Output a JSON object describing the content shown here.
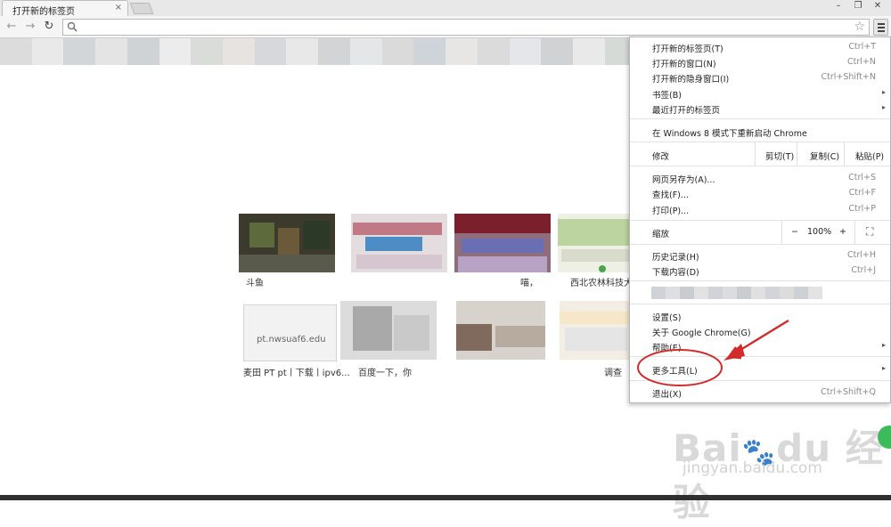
{
  "browser": {
    "tab_title": "打开新的标签页",
    "tab_close": "×",
    "window_minimize": "–",
    "window_restore": "❐",
    "window_close": "✕",
    "nav_icons": [
      "back-icon",
      "forward-icon",
      "reload-icon"
    ],
    "omnibox_value": ""
  },
  "tiles": [
    {
      "label": "斗鱼"
    },
    {
      "label": "喵，"
    },
    {
      "label": "西北农林科技大学"
    },
    {
      "label": "麦田 PT pt丨下载丨ipv6..."
    },
    {
      "label": "百度一下，你"
    },
    {
      "label": "调查"
    }
  ],
  "tile_pt_text": "pt.nwsuaf6.edu",
  "menu": {
    "new_tab": {
      "label": "打开新的标签页(T)",
      "shortcut": "Ctrl+T"
    },
    "new_window": {
      "label": "打开新的窗口(N)",
      "shortcut": "Ctrl+N"
    },
    "new_incognito": {
      "label": "打开新的隐身窗口(I)",
      "shortcut": "Ctrl+Shift+N"
    },
    "bookmarks": {
      "label": "书签(B)"
    },
    "recent_tabs": {
      "label": "最近打开的标签页"
    },
    "relaunch_win8": {
      "label": "在 Windows 8 模式下重新启动 Chrome"
    },
    "edit": {
      "label": "修改",
      "cut": "剪切(T)",
      "copy": "复制(C)",
      "paste": "粘贴(P)"
    },
    "save_page": {
      "label": "网页另存为(A)...",
      "shortcut": "Ctrl+S"
    },
    "find": {
      "label": "查找(F)...",
      "shortcut": "Ctrl+F"
    },
    "print": {
      "label": "打印(P)...",
      "shortcut": "Ctrl+P"
    },
    "zoom": {
      "label": "缩放",
      "minus": "−",
      "value": "100%",
      "plus": "+",
      "fullscreen": "⛶"
    },
    "history": {
      "label": "历史记录(H)",
      "shortcut": "Ctrl+H"
    },
    "downloads": {
      "label": "下载内容(D)",
      "shortcut": "Ctrl+J"
    },
    "settings": {
      "label": "设置(S)"
    },
    "about": {
      "label": "关于 Google Chrome(G)"
    },
    "help": {
      "label": "帮助(E)"
    },
    "more_tools": {
      "label": "更多工具(L)"
    },
    "exit": {
      "label": "退出(X)",
      "shortcut": "Ctrl+Shift+Q"
    },
    "submenu_arrow": "▸"
  },
  "colors": {
    "annotation_red": "#d42a2a",
    "menu_border": "#b7b7b7"
  }
}
